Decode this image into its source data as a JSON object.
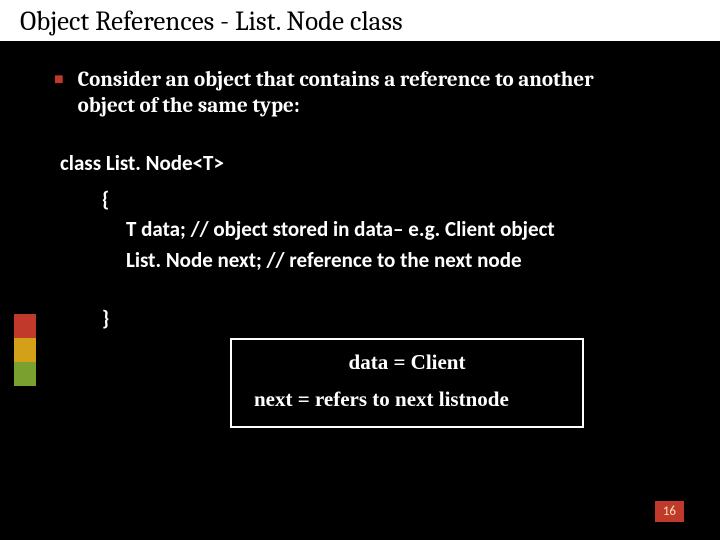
{
  "title": "Object References  - List. Node class",
  "bullet": {
    "l1a": "Consider an ",
    "l1b": "object ",
    "l1c": "that contains a ",
    "l1d": "reference to another",
    "l2": "object of the same type:"
  },
  "code": {
    "cls": "class List. Node<T>",
    "brace_open": "{",
    "line1": "T data;   // object stored  in data– e.g. Client object",
    "line2": "List. Node next;   // reference to the next node",
    "brace_close": "}"
  },
  "box": {
    "r1": "data = Client",
    "r2": "next  = refers to next listnode"
  },
  "page": "16"
}
